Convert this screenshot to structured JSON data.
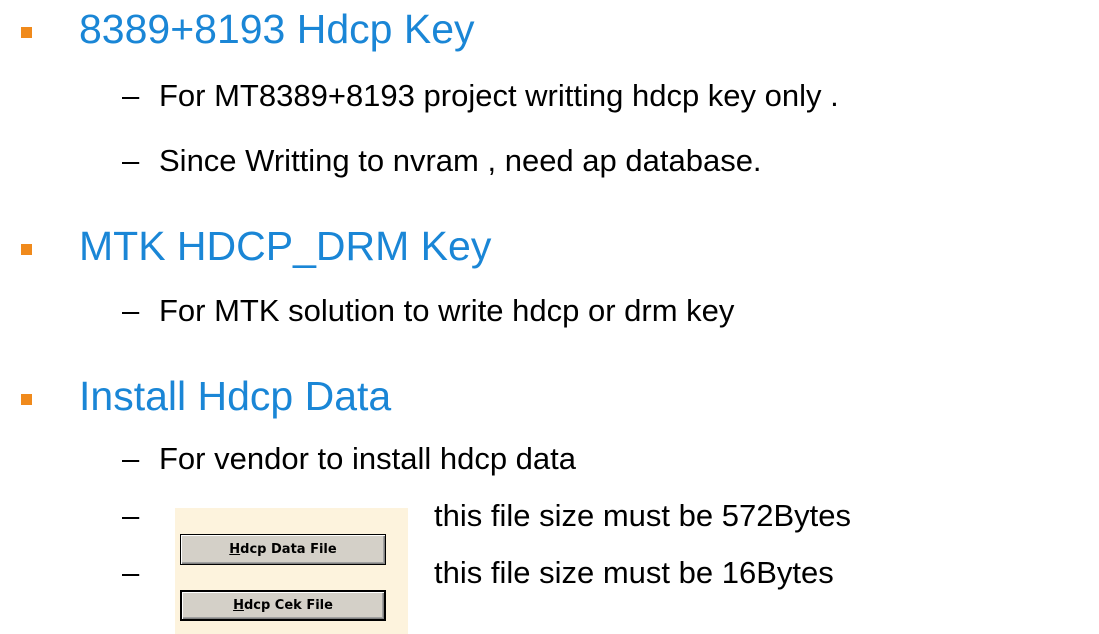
{
  "sections": [
    {
      "heading": "8389+8193 Hdcp Key",
      "items": [
        "For MT8389+8193 project writting hdcp key only .",
        "Since Writting to nvram , need ap database."
      ]
    },
    {
      "heading": "MTK HDCP_DRM Key",
      "items": [
        "For MTK solution to write hdcp or drm key"
      ]
    },
    {
      "heading": "Install Hdcp Data",
      "items": [
        "For vendor to install hdcp data",
        "this file size must be 572Bytes",
        "this file size must be 16Bytes"
      ]
    }
  ],
  "dash_symbol": "–",
  "buttons": {
    "data_file": {
      "mnemonic": "H",
      "rest": "dcp Data File"
    },
    "cek_file": {
      "mnemonic": "H",
      "rest": "dcp Cek File"
    }
  },
  "colors": {
    "heading": "#1a86d6",
    "bullet": "#f08a1c",
    "body_text": "#000000",
    "button_face": "#d4d0c8",
    "button_highlight": "#fdf3dd"
  }
}
